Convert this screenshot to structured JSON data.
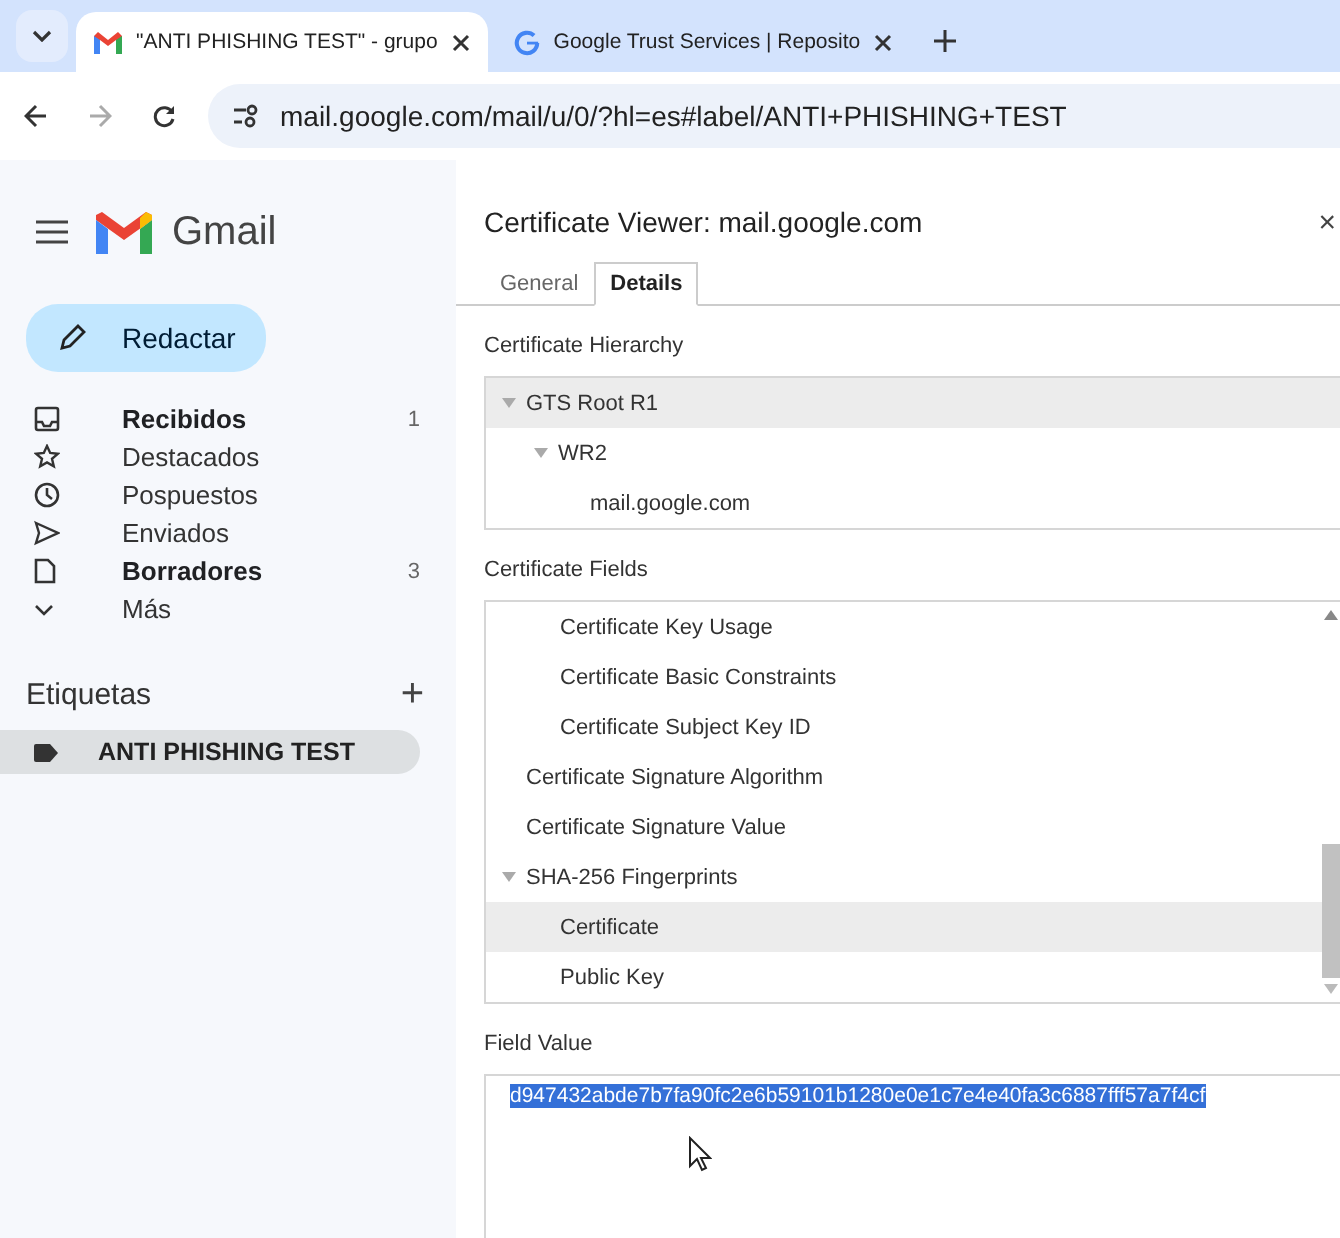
{
  "browser": {
    "tabs": [
      {
        "title": "\"ANTI PHISHING TEST\" - grupo",
        "kind": "gmail",
        "selected": true
      },
      {
        "title": "Google Trust Services | Reposito",
        "kind": "google",
        "selected": false
      }
    ],
    "url": "mail.google.com/mail/u/0/?hl=es#label/ANTI+PHISHING+TEST"
  },
  "sidebar": {
    "app_name": "Gmail",
    "compose": "Redactar",
    "items": [
      {
        "label": "Recibidos",
        "kind": "inbox",
        "count": "1",
        "bold": true
      },
      {
        "label": "Destacados",
        "kind": "starred",
        "bold": false
      },
      {
        "label": "Pospuestos",
        "kind": "snoozed",
        "bold": false
      },
      {
        "label": "Enviados",
        "kind": "sent",
        "bold": false
      },
      {
        "label": "Borradores",
        "kind": "drafts",
        "count": "3",
        "bold": true
      },
      {
        "label": "Más",
        "kind": "more",
        "bold": false
      }
    ],
    "labels_heading": "Etiquetas",
    "add": "+",
    "labels": [
      {
        "label": "ANTI PHISHING TEST",
        "selected": true
      }
    ]
  },
  "dialog": {
    "title": "Certificate Viewer: mail.google.com",
    "close": "×",
    "tabs": [
      {
        "label": "General",
        "selected": false
      },
      {
        "label": "Details",
        "selected": true
      }
    ],
    "hierarchy_heading": "Certificate Hierarchy",
    "hierarchy": [
      {
        "label": "GTS Root R1",
        "selected": true,
        "expanded": true,
        "children": [
          {
            "label": "WR2",
            "selected": false,
            "expanded": true,
            "children": [
              {
                "label": "mail.google.com",
                "selected": false
              }
            ]
          }
        ]
      }
    ],
    "fields_heading": "Certificate Fields",
    "fields": [
      {
        "children": [
          {
            "label": "Certificate Key Usage",
            "selected": false
          },
          {
            "label": "Certificate Basic Constraints",
            "selected": false
          },
          {
            "label": "Certificate Subject Key ID",
            "selected": false
          }
        ]
      },
      {
        "label": "Certificate Signature Algorithm",
        "selected": false
      },
      {
        "label": "Certificate Signature Value",
        "selected": false
      },
      {
        "label": "SHA-256 Fingerprints",
        "selected": false,
        "expanded": true,
        "children": [
          {
            "label": "Certificate",
            "selected": true
          },
          {
            "label": "Public Key",
            "selected": false
          }
        ]
      }
    ],
    "value_heading": "Field Value",
    "value": "d947432abde7b7fa90fc2e6b59101b1280e0e1c7e4e40fa3c6887fff57a7f4cf"
  }
}
